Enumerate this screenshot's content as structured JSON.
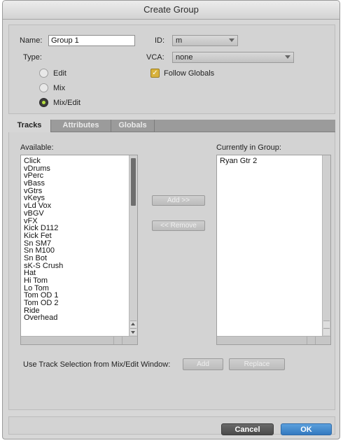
{
  "window": {
    "title": "Create Group"
  },
  "form": {
    "name_label": "Name:",
    "name_value": "Group 1",
    "id_label": "ID:",
    "id_value": "m",
    "type_label": "Type:",
    "vca_label": "VCA:",
    "vca_value": "none",
    "type_options": [
      {
        "label": "Edit",
        "selected": false
      },
      {
        "label": "Mix",
        "selected": false
      },
      {
        "label": "Mix/Edit",
        "selected": true
      }
    ],
    "follow_globals_label": "Follow Globals",
    "follow_globals_checked": true
  },
  "tabs": [
    {
      "label": "Tracks",
      "active": true
    },
    {
      "label": "Attributes",
      "active": false
    },
    {
      "label": "Globals",
      "active": false
    }
  ],
  "tracks": {
    "available_label": "Available:",
    "available": [
      "Click",
      "vDrums",
      "vPerc",
      "vBass",
      "vGtrs",
      "vKeys",
      "vLd Vox",
      "vBGV",
      "vFX",
      "Kick D112",
      "Kick Fet",
      "Sn SM7",
      "Sn M100",
      "Sn Bot",
      "sK-S Crush",
      "Hat",
      "Hi Tom",
      "Lo Tom",
      "Tom OD 1",
      "Tom OD 2",
      "Ride",
      "Overhead"
    ],
    "in_group_label": "Currently in Group:",
    "in_group": [
      "Ryan Gtr 2"
    ],
    "add_button": "Add >>",
    "remove_button": "<< Remove",
    "use_selection_label": "Use Track Selection from Mix/Edit Window:",
    "use_add_button": "Add",
    "use_replace_button": "Replace"
  },
  "footer": {
    "cancel_label": "Cancel",
    "ok_label": "OK"
  },
  "colors": {
    "accent_ok": "#3f87c9",
    "cancel": "#5a5a5a",
    "radio_selected": "#b6e13f",
    "checkbox": "#d8b23c"
  }
}
